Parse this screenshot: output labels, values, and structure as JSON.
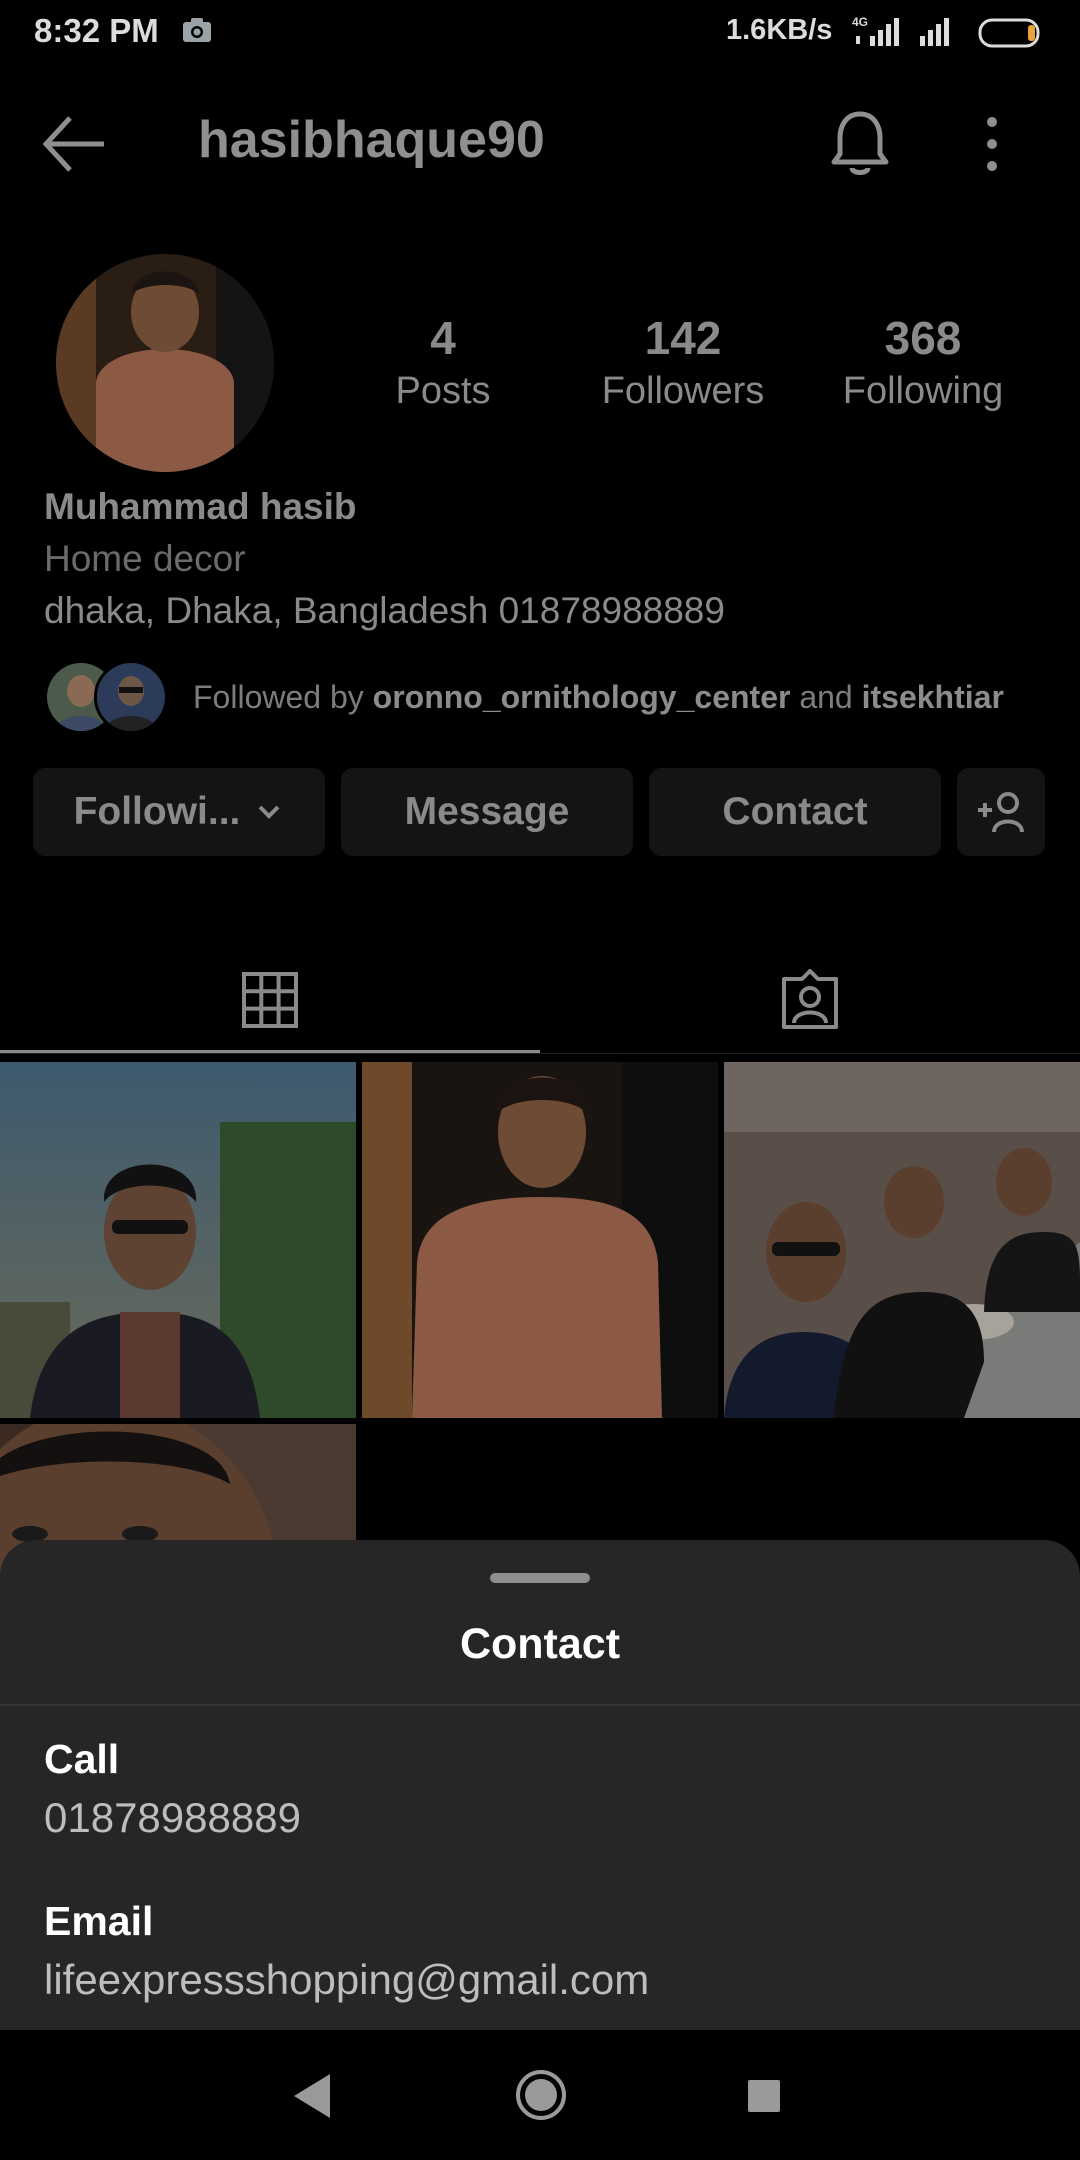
{
  "status_bar": {
    "time": "8:32 PM",
    "network_speed": "1.6KB/s",
    "network_type": "4G",
    "icons": [
      "camera-icon",
      "signal-icon",
      "signal-icon",
      "battery-icon"
    ]
  },
  "header": {
    "username": "hasibhaque90",
    "icons": [
      "back-arrow-icon",
      "bell-icon",
      "more-vertical-icon"
    ]
  },
  "profile": {
    "stats": [
      {
        "value": "4",
        "label": "Posts"
      },
      {
        "value": "142",
        "label": "Followers"
      },
      {
        "value": "368",
        "label": "Following"
      }
    ],
    "name": "Muhammad hasib",
    "category": "Home decor",
    "bio": "dhaka, Dhaka, Bangladesh 01878988889",
    "followed_by": {
      "prefix": "Followed by ",
      "user1": "oronno_ornithology_center",
      "middle": " and ",
      "user2": "itsekhtiar"
    }
  },
  "actions": {
    "following": "Followi...",
    "message": "Message",
    "contact": "Contact",
    "add_user_icon": "add-user-icon"
  },
  "tabs": [
    {
      "name": "grid",
      "icon": "grid-icon",
      "active": true
    },
    {
      "name": "tagged",
      "icon": "tagged-person-icon",
      "active": false
    }
  ],
  "sheet": {
    "title": "Contact",
    "call_label": "Call",
    "call_value": "01878988889",
    "email_label": "Email",
    "email_value": "lifeexpressshopping@gmail.com"
  },
  "nav": {
    "icons": [
      "nav-back-icon",
      "nav-home-icon",
      "nav-recent-icon"
    ]
  },
  "colors": {
    "background": "#000000",
    "sheet": "#262626",
    "button": "#141414",
    "text_dim": "#8a8a8a"
  }
}
